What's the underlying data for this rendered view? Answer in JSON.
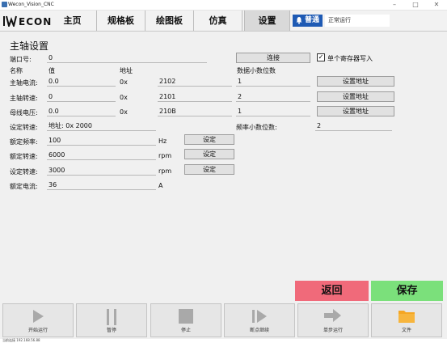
{
  "window": {
    "title": "Wecon_Vision_CNC",
    "minimize": "–",
    "maximize": "□",
    "close": "✕"
  },
  "nav": {
    "logo": "WECON",
    "tabs": [
      "主页",
      "规格板",
      "绘图板",
      "仿真",
      "设置"
    ],
    "active_tab": "设置",
    "mode_badge": "普通",
    "status": "正常运行"
  },
  "spindle": {
    "section_title": "主轴设置",
    "port_label": "端口号:",
    "port_value": "0",
    "connect_button": "连接",
    "single_register_write": {
      "label": "单个寄存器写入",
      "checked": true
    },
    "headers": {
      "name": "名称",
      "value": "值",
      "address": "地址",
      "decimals": "数据小数位数"
    },
    "rows": [
      {
        "name": "主轴电流:",
        "value": "0.0",
        "prefix": "0x",
        "address": "2102",
        "decimals": "1",
        "button": "设置地址"
      },
      {
        "name": "主轴转速:",
        "value": "0",
        "prefix": "0x",
        "address": "2101",
        "decimals": "2",
        "button": "设置地址"
      },
      {
        "name": "母线电压:",
        "value": "0.0",
        "prefix": "0x",
        "address": "210B",
        "decimals": "1",
        "button": "设置地址"
      }
    ],
    "set_speed_address": {
      "label": "设定转速:",
      "value": "地址: 0x 2000"
    },
    "freq_decimals": {
      "label": "频率小数位数:",
      "value": "2"
    },
    "rated": [
      {
        "label": "额定频率:",
        "value": "100",
        "unit": "Hz",
        "button": "设定"
      },
      {
        "label": "额定转速:",
        "value": "6000",
        "unit": "rpm",
        "button": "设定"
      },
      {
        "label": "设定转速:",
        "value": "3000",
        "unit": "rpm",
        "button": "设定"
      },
      {
        "label": "额定电流:",
        "value": "36",
        "unit": "A"
      }
    ]
  },
  "actions": {
    "back": "返回",
    "save": "保存"
  },
  "toolbar": [
    {
      "label": "开始运行",
      "icon": "play-icon"
    },
    {
      "label": "暂停",
      "icon": "pause-icon"
    },
    {
      "label": "停止",
      "icon": "stop-icon"
    },
    {
      "label": "断点继续",
      "icon": "resume-icon"
    },
    {
      "label": "单步运行",
      "icon": "step-icon"
    },
    {
      "label": "文件",
      "icon": "folder-icon"
    }
  ],
  "statusbar": {
    "text": "当前连接 192.168.56.88"
  },
  "colors": {
    "accent_blue": "#1e5ab4",
    "back_red": "#f06a7a",
    "save_green": "#7be07b",
    "folder_orange": "#f5a623"
  }
}
